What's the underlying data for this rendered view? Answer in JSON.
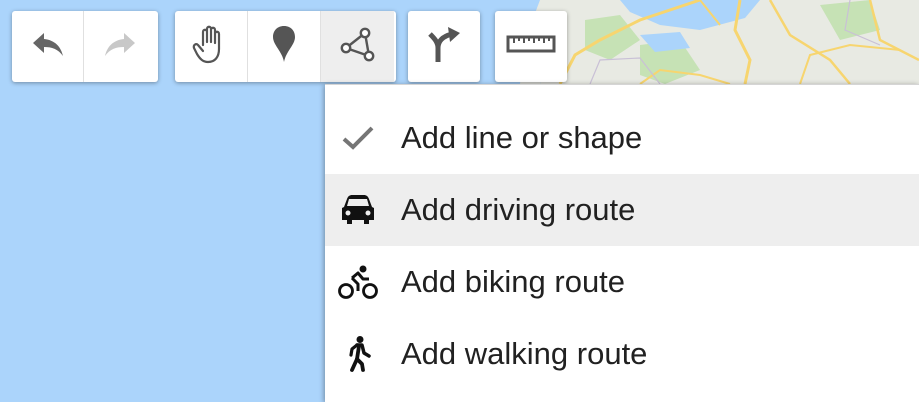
{
  "toolbar": {
    "history": [
      {
        "icon": "undo-icon",
        "state": "enabled"
      },
      {
        "icon": "redo-icon",
        "state": "disabled"
      }
    ],
    "tools": [
      {
        "icon": "hand-pan-icon"
      },
      {
        "icon": "marker-pin-icon"
      },
      {
        "icon": "line-shape-icon",
        "state": "active"
      }
    ],
    "directions": {
      "icon": "directions-fork-icon"
    },
    "measure": {
      "icon": "ruler-icon"
    }
  },
  "menu": {
    "items": [
      {
        "label": "Add line or shape",
        "icon": "checkmark-icon",
        "selected": true
      },
      {
        "label": "Add driving route",
        "icon": "car-icon",
        "hovered": true
      },
      {
        "label": "Add biking route",
        "icon": "bicycle-icon"
      },
      {
        "label": "Add walking route",
        "icon": "walking-person-icon"
      }
    ]
  },
  "colors": {
    "water": "#abd4fb",
    "land": "#e8eae3",
    "road": "#f7d56f",
    "park": "#c6e2b5",
    "menu_hover": "#eeeeee",
    "icon_gray": "#666666",
    "text": "#212121"
  }
}
